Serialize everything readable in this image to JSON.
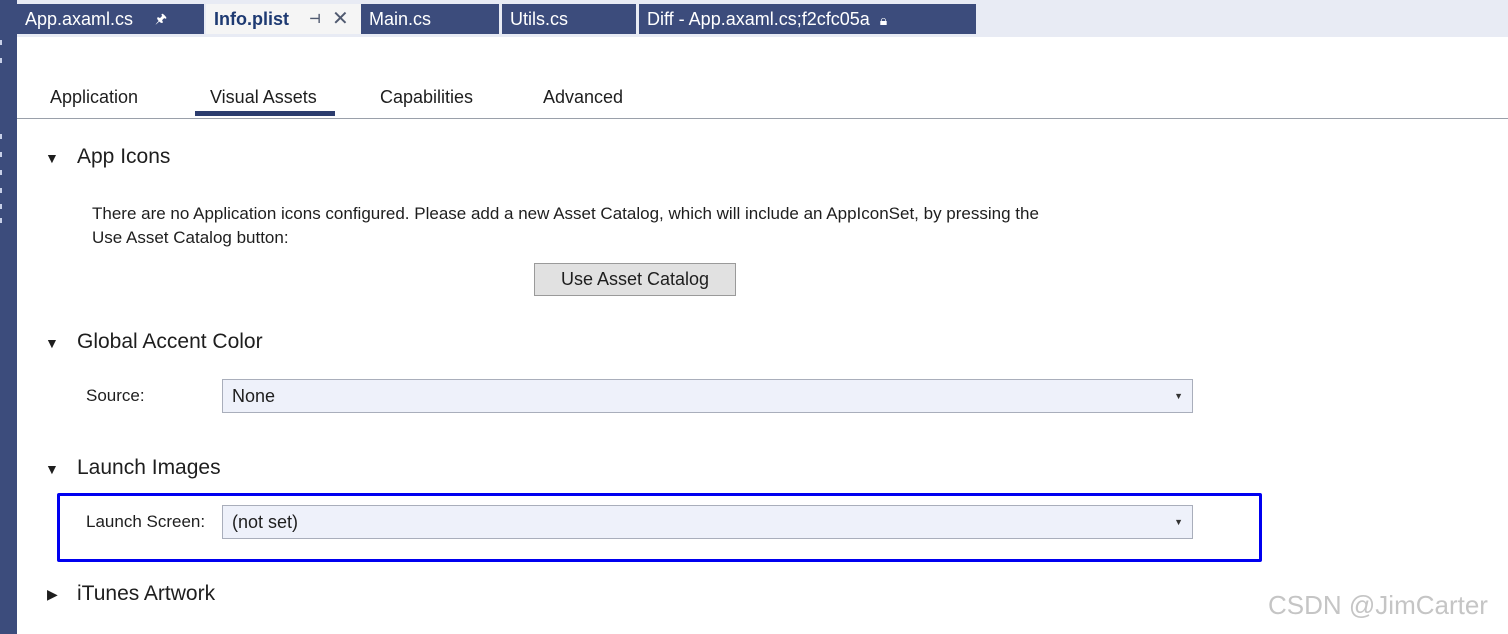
{
  "document_tabs": [
    {
      "label": "App.axaml.cs",
      "pinned": true,
      "active": false
    },
    {
      "label": "Info.plist",
      "pinned": true,
      "active": true
    },
    {
      "label": "Main.cs",
      "active": false
    },
    {
      "label": "Utils.cs",
      "active": false
    },
    {
      "label": "Diff - App.axaml.cs;f2cfc05a",
      "locked": true,
      "active": false
    }
  ],
  "page_tabs": [
    {
      "label": "Application",
      "active": false
    },
    {
      "label": "Visual Assets",
      "active": true
    },
    {
      "label": "Capabilities",
      "active": false
    },
    {
      "label": "Advanced",
      "active": false
    }
  ],
  "sections": {
    "app_icons": {
      "title": "App Icons",
      "expanded": true,
      "description_line1": "There are no Application icons configured. Please add a new Asset Catalog, which will include an AppIconSet, by pressing the",
      "description_line2": "Use Asset Catalog button:",
      "button_label": "Use Asset Catalog"
    },
    "global_accent_color": {
      "title": "Global Accent Color",
      "expanded": true,
      "source_label": "Source:",
      "source_value": "None"
    },
    "launch_images": {
      "title": "Launch Images",
      "expanded": true,
      "launch_screen_label": "Launch Screen:",
      "launch_screen_value": "(not set)"
    },
    "itunes_artwork": {
      "title": "iTunes Artwork",
      "expanded": false
    }
  },
  "icons": {
    "expanded": "chevron-down-icon",
    "collapsed": "chevron-right-icon",
    "pin": "pin-icon",
    "close": "close-icon",
    "lock": "lock-icon",
    "dropdown": "dropdown-arrow-icon"
  },
  "colors": {
    "tab_inactive_bg": "#3c4c7c",
    "tab_active_text": "#1e3a72",
    "highlight_border": "#0000f0"
  },
  "watermark": "CSDN @JimCarter"
}
